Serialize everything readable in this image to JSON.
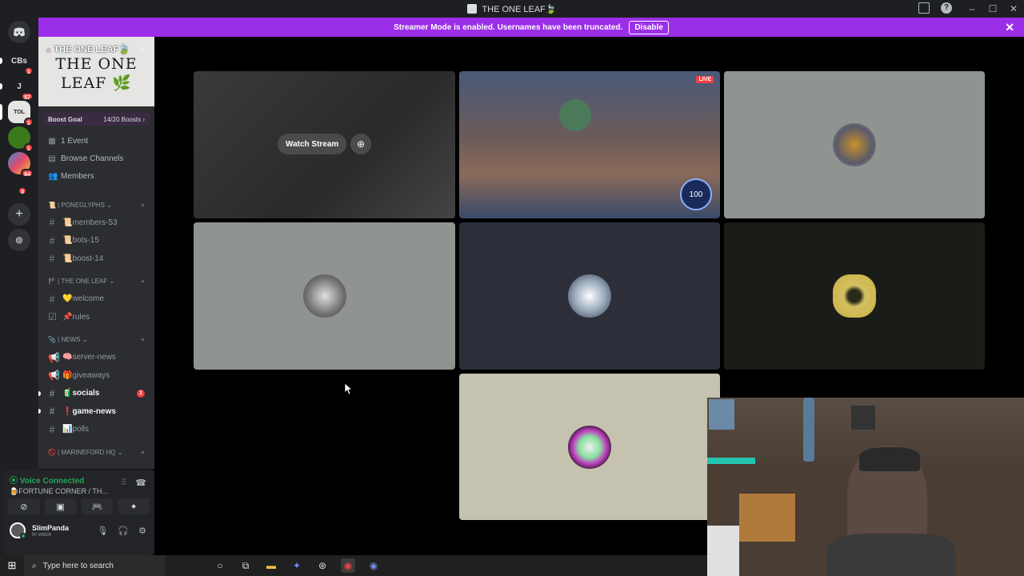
{
  "window": {
    "title": "THE ONE LEAF🍃"
  },
  "banner": {
    "text": "Streamer Mode is enabled. Usernames have been truncated.",
    "disable_label": "Disable"
  },
  "rail": {
    "servers": [
      {
        "label": "CBs",
        "badge": "1"
      },
      {
        "label": "J",
        "badge": "57"
      },
      {
        "label": "TOL",
        "badge": "1"
      },
      {
        "label": "",
        "badge": "1"
      },
      {
        "label": "",
        "badge": "64"
      },
      {
        "label": "",
        "badge": "3"
      }
    ]
  },
  "server": {
    "name": "THE ONE LEAF🍃",
    "banner_line1": "THE ONE",
    "banner_line2": "LEAF 🌿",
    "boost_goal": "Boost Goal",
    "boost_count": "14/20 Boosts"
  },
  "nav": {
    "events": "1 Event",
    "browse": "Browse Channels",
    "members": "Members"
  },
  "categories": [
    {
      "name": "📜 | PONEGLYPHS",
      "channels": [
        {
          "name": "📜members-53",
          "unread": false
        },
        {
          "name": "📜bots-15",
          "unread": false
        },
        {
          "name": "📜boost-14",
          "unread": false
        }
      ]
    },
    {
      "name": "🏴 | THE ONE LEAF",
      "channels": [
        {
          "name": "💛welcome",
          "unread": false
        },
        {
          "name": "📌rules",
          "unread": false
        }
      ]
    },
    {
      "name": "📎 | NEWS",
      "channels": [
        {
          "name": "🧠server-news",
          "unread": false
        },
        {
          "name": "🎁giveaways",
          "unread": false
        },
        {
          "name": "🧃socials",
          "unread": true,
          "badge": "1"
        },
        {
          "name": "❗game-news",
          "unread": true
        },
        {
          "name": "📊polls",
          "unread": false
        }
      ]
    },
    {
      "name": "🚫 | MARINEFORD HQ",
      "channels": []
    }
  ],
  "voice": {
    "status": "Voice Connected",
    "channel": "🍺FORTUNE CORNER / TH...",
    "user": "SlimPanda",
    "user_status": "In voice"
  },
  "stream": {
    "watch_label": "Watch Stream",
    "live_label": "LIVE",
    "boost_meter": "100"
  },
  "taskbar": {
    "search_placeholder": "Type here to search"
  },
  "colors": {
    "brand_purple": "#9b2ee8",
    "voice_green": "#23a55a",
    "badge_red": "#f23f42"
  }
}
